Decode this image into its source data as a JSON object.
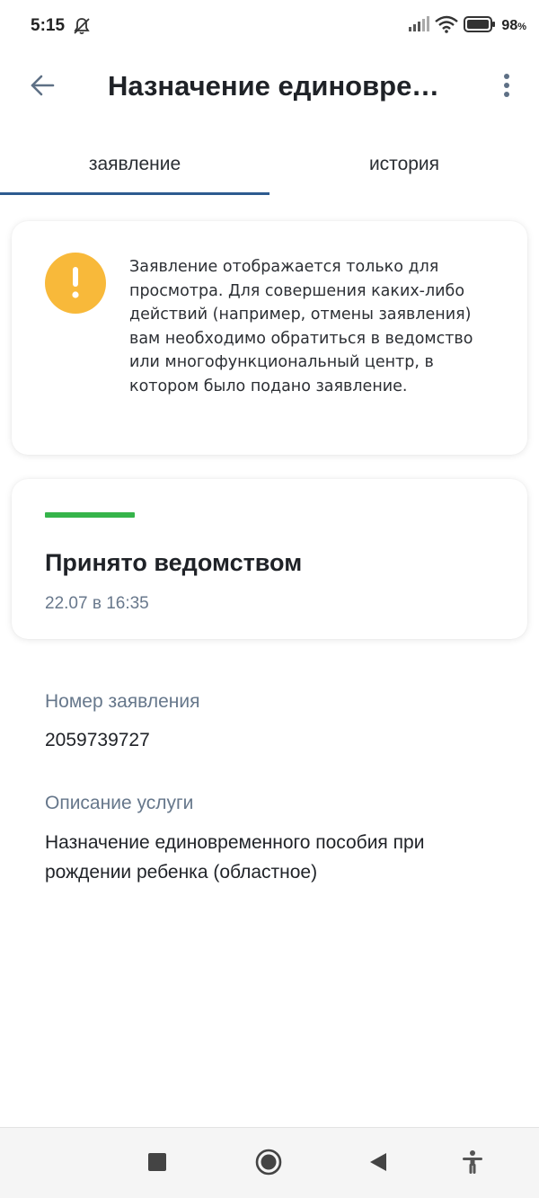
{
  "status_bar": {
    "time": "5:15",
    "battery": "98",
    "battery_unit": "%",
    "icons": [
      "bell-off-icon",
      "signal-icon",
      "wifi-icon",
      "battery-icon"
    ]
  },
  "app_bar": {
    "title": "Назначение единовременного пособия при рождении ребенка (областное)"
  },
  "tabs": [
    {
      "label": "заявление",
      "active": true
    },
    {
      "label": "история",
      "active": false
    }
  ],
  "notice": {
    "icon": "exclamation-icon",
    "text": "Заявление отображается только для просмотра. Для совершения каких-либо действий (например, отмены заявления) вам необходимо обратиться в ведомство или многофункциональный центр, в котором было подано заявление."
  },
  "status_card": {
    "title": "Принято ведомством",
    "date": "22.07 в 16:35",
    "progress": 1.0
  },
  "details": {
    "number_label": "Номер заявления",
    "number_value": "2059739727",
    "service_label": "Описание услуги",
    "service_value": "Назначение единовременного пособия при рождении ребенка (областное)"
  },
  "colors": {
    "accent": "#2d5b8f",
    "warning": "#f8b93a",
    "success": "#35b44a",
    "muted": "#68788c"
  }
}
